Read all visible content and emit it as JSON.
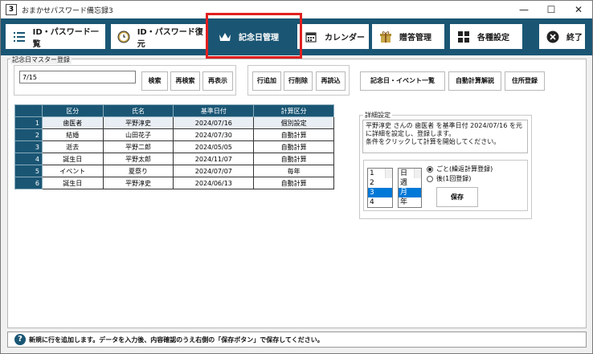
{
  "window": {
    "app_icon": "3",
    "title": "おまかせパスワード備忘録3",
    "min": "—",
    "max": "☐",
    "close": "✕"
  },
  "toolbar": {
    "items": [
      {
        "label": "ID・パスワード一覧",
        "icon": "list-icon"
      },
      {
        "label": "ID・パスワード復元",
        "icon": "restore-clock-icon"
      },
      {
        "label": "記念日管理",
        "icon": "crown-icon"
      },
      {
        "label": "カレンダー",
        "icon": "calendar-icon"
      },
      {
        "label": "贈答管理",
        "icon": "gift-icon"
      },
      {
        "label": "各種設定",
        "icon": "grid-settings-icon"
      },
      {
        "label": "終了",
        "icon": "close-circle-icon"
      }
    ],
    "active_index": 2
  },
  "master": {
    "group_label": "記念日マスター登録",
    "search_value": "7/15",
    "buttons": {
      "search": "検索",
      "re_search": "再検索",
      "redisplay": "再表示",
      "add_row": "行追加",
      "delete_row": "行削除",
      "reload": "再読込",
      "event_list": "記念日・イベント一覧",
      "auto_calc": "自動計算解説",
      "address": "住所登録"
    }
  },
  "table": {
    "headers": [
      "区分",
      "氏名",
      "基準日付",
      "計算区分"
    ],
    "rows": [
      {
        "no": "1",
        "kubun": "歯医者",
        "name": "平野淳史",
        "date": "2024/07/16",
        "calc": "個別設定"
      },
      {
        "no": "2",
        "kubun": "結婚",
        "name": "山田花子",
        "date": "2024/07/30",
        "calc": "自動計算"
      },
      {
        "no": "3",
        "kubun": "逝去",
        "name": "平野二郎",
        "date": "2024/05/05",
        "calc": "自動計算"
      },
      {
        "no": "4",
        "kubun": "誕生日",
        "name": "平野太郎",
        "date": "2024/11/07",
        "calc": "自動計算"
      },
      {
        "no": "5",
        "kubun": "イベント",
        "name": "夏祭り",
        "date": "2024/07/07",
        "calc": "毎年"
      },
      {
        "no": "6",
        "kubun": "誕生日",
        "name": "平野淳史",
        "date": "2024/06/13",
        "calc": "自動計算"
      }
    ]
  },
  "detail": {
    "label": "詳細設定",
    "text_line1": "平野淳史 さんの 歯医者 を基準日付 2024/07/16 を元",
    "text_line2": "に詳細を設定し、登録します。",
    "text_line3": "条件をクリックして計算を開始してください。",
    "numbers": [
      "1",
      "2",
      "3",
      "4"
    ],
    "number_selected": "3",
    "units": [
      "日",
      "週",
      "月",
      "年"
    ],
    "unit_selected": "月",
    "radio_every": "ごと(繰返計算登録)",
    "radio_after": "後(1回登録)",
    "save": "保存"
  },
  "status": {
    "icon": "?",
    "message": "新規に行を追加します。データを入力後、内容確認のうえ右側の「保存ボタン」で保存してください。"
  },
  "colors": {
    "primary": "#1a5674",
    "highlight": "#e02020",
    "selection": "#0078d7"
  }
}
